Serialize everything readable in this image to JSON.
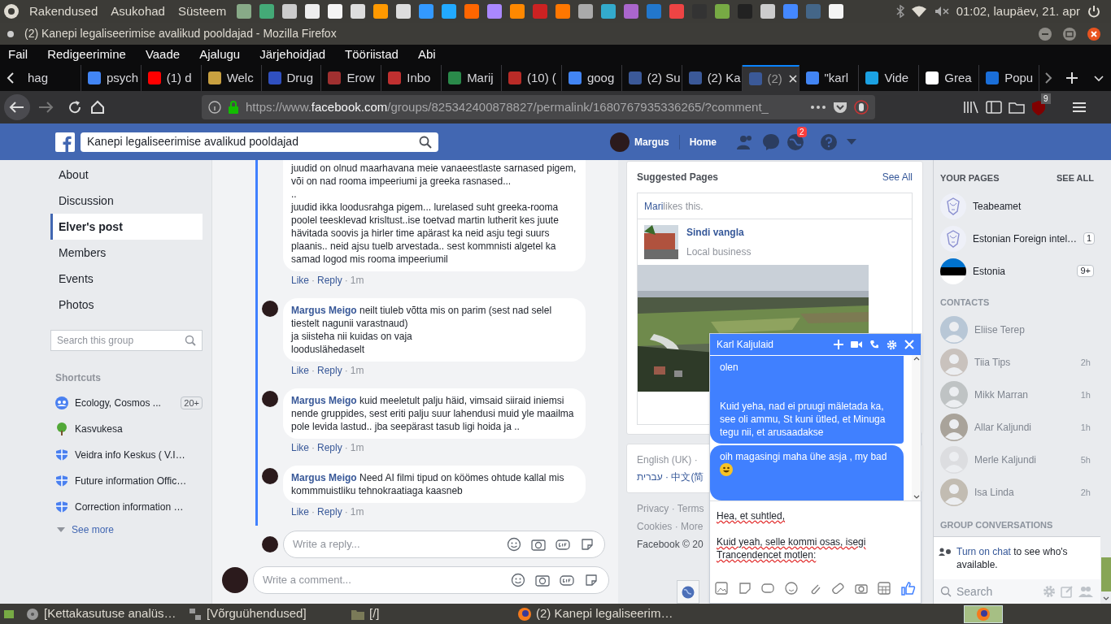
{
  "top_panel": {
    "menus": [
      "Rakendused",
      "Asukohad",
      "Süsteem"
    ],
    "clock": "01:02, laupäev, 21. apr"
  },
  "window": {
    "title": "(2) Kanepi legaliseerimise avalikud pooldajad - Mozilla Firefox"
  },
  "menu_bar": [
    "Fail",
    "Redigeerimine",
    "Vaade",
    "Ajalugu",
    "Järjehoidjad",
    "Tööriistad",
    "Abi"
  ],
  "tabs": [
    {
      "label": "hag",
      "selected": false
    },
    {
      "label": "psych",
      "selected": false,
      "color": "#4285f4"
    },
    {
      "label": "(1) d",
      "selected": false,
      "color": "#ff0000"
    },
    {
      "label": "Welc",
      "selected": false,
      "color": "#c8a040"
    },
    {
      "label": "Drug",
      "selected": false,
      "color": "#3050c0"
    },
    {
      "label": "Erow",
      "selected": false,
      "color": "#a03030"
    },
    {
      "label": "Inbo",
      "selected": false,
      "color": "#c03030"
    },
    {
      "label": "Marij",
      "selected": false,
      "color": "#2a8a4a"
    },
    {
      "label": "(10) (",
      "selected": false,
      "color": "#b92b27"
    },
    {
      "label": "goog",
      "selected": false,
      "color": "#4285f4"
    },
    {
      "label": "(2) Su",
      "selected": false,
      "color": "#3b5998"
    },
    {
      "label": "(2) Ka",
      "selected": false,
      "color": "#3b5998"
    },
    {
      "label": "(2)",
      "selected": true,
      "color": "#3b5998"
    },
    {
      "label": "\"karl",
      "selected": false,
      "color": "#4285f4"
    },
    {
      "label": "Vide",
      "selected": false,
      "color": "#1ba1e2"
    },
    {
      "label": "Grea",
      "selected": false,
      "color": "#ffffff"
    },
    {
      "label": "Popu",
      "selected": false,
      "color": "#1a6ed8"
    }
  ],
  "address_bar": {
    "prefix": "https://www.",
    "host": "facebook.com",
    "path": "/groups/825342400878827/permalink/1680767935336265/?comment_",
    "addon_badge": "9"
  },
  "facebook_bar": {
    "search_value": "Kanepi legaliseerimise avalikud pooldajad",
    "user": "Margus",
    "home": "Home",
    "notifications": "2"
  },
  "group_nav": [
    {
      "label": "About",
      "selected": false
    },
    {
      "label": "Discussion",
      "selected": false
    },
    {
      "label": "Elver's post",
      "selected": true
    },
    {
      "label": "Members",
      "selected": false
    },
    {
      "label": "Events",
      "selected": false
    },
    {
      "label": "Photos",
      "selected": false
    }
  ],
  "group_search": {
    "placeholder": "Search this group"
  },
  "shortcuts": {
    "title": "Shortcuts",
    "items": [
      {
        "label": "Ecology, Cosmos ...",
        "badge": "20+",
        "kind": "group"
      },
      {
        "label": "Kasvukesa",
        "kind": "tree"
      },
      {
        "label": "Veidra info Keskus ( V.I…",
        "kind": "shield"
      },
      {
        "label": "Future information Offic…",
        "kind": "shield"
      },
      {
        "label": "Correction information …",
        "kind": "shield"
      }
    ],
    "see_more": "See more"
  },
  "comments": [
    {
      "text": "juudid on olnud maarhavana meie vanaeestlaste sarnased pigem, või on nad rooma impeeriumi ja greeka rasnased...\n..\njuudid ikka loodusrahga pigem... lurelased suht greeka-rooma poolel teesklevad krisltust..ise toetvad martin lutherit kes juute hävitada soovis ja hirler time apärast ka neid asju tegi suurs plaanis.. neid ajsu tuelb arvestada.. sest kommnisti algetel ka samad logod mis rooma impeeriumil",
      "like": "Like",
      "separator": "·",
      "reply": "Reply",
      "time": "1m"
    },
    {
      "author": "Margus Meigo",
      "text": "neilt tiuleb võtta mis on parim (sest nad selel tiestelt nagunii varastnaud)\nja siisteha nii kuidas on vaja\nlooduslähedaselt",
      "like": "Like",
      "separator": "·",
      "reply": "Reply",
      "time": "1m"
    },
    {
      "author": "Margus Meigo",
      "text": "kuid meeletult palju häid, vimsaid siiraid iniemsi nende gruppides, sest eriti palju suur lahendusi muid yle maailma pole levida lastud.. jba seepärast tasub ligi hoida ja ..",
      "like": "Like",
      "separator": "·",
      "reply": "Reply",
      "time": "1m"
    },
    {
      "author": "Margus Meigo",
      "text": "Need AI filmi tipud on köömes ohtude kallal mis kommmuistliku tehnokraatiaga kaasneb",
      "like": "Like",
      "separator": "·",
      "reply": "Reply",
      "time": "1m"
    }
  ],
  "reply_box": {
    "placeholder": "Write a reply..."
  },
  "comment_box": {
    "placeholder": "Write a comment..."
  },
  "suggested_pages": {
    "title": "Suggested Pages",
    "see_all": "See All",
    "liker": "Mari",
    "likes_text": "likes this.",
    "page_name": "Sindi vangla",
    "category": "Local business"
  },
  "footer": {
    "languages": [
      "English (UK) ·",
      "עברית · 中文(简"
    ],
    "links": [
      "Privacy · Terms",
      "Cookies · More"
    ],
    "copyright": "Facebook © 20"
  },
  "chat_window": {
    "name": "Karl Kaljulaid",
    "messages": [
      {
        "text": "olen\n\n\nKuid yeha, nad ei pruugi mäletada ka, see oli ammu, St kuni ütled, et Minuga tegu nii, et arusaadakse",
        "emoji": false
      },
      {
        "text": "oih magasingi maha ühe asja , my bad",
        "emoji": true
      }
    ],
    "draft": "Hea, et suhtled,\n\nKuid yeah, selle kommi osas, isegi Trancendencet motlen:"
  },
  "chat_sidebar": {
    "pages_title": "YOUR PAGES",
    "see_all": "SEE ALL",
    "pages": [
      {
        "name": "Teabeamet",
        "kind": "crest"
      },
      {
        "name": "Estonian Foreign intel…",
        "badge": "1",
        "kind": "crest"
      },
      {
        "name": "Estonia",
        "badge": "9+",
        "kind": "flag"
      }
    ],
    "contacts_title": "CONTACTS",
    "contacts": [
      {
        "name": "Eliise Terep"
      },
      {
        "name": "Tiia Tips",
        "time": "2h"
      },
      {
        "name": "Mikk Marran",
        "time": "1h"
      },
      {
        "name": "Allar Kaljundi",
        "time": "1h"
      },
      {
        "name": "Merle Kaljundi",
        "time": "5h"
      },
      {
        "name": "Isa Linda",
        "time": "2h"
      }
    ],
    "groups_title": "GROUP CONVERSATIONS",
    "notice_link": "Turn on chat",
    "notice_text": "to see who's available.",
    "search_placeholder": "Search"
  },
  "taskbar": [
    {
      "label": "[Kettakasutuse analüs…",
      "kind": "disk"
    },
    {
      "label": "[Võrguühendused]",
      "kind": "network"
    },
    {
      "label": "[/]",
      "kind": "folder"
    },
    {
      "label": "(2) Kanepi legaliseerim…",
      "kind": "browser"
    }
  ]
}
